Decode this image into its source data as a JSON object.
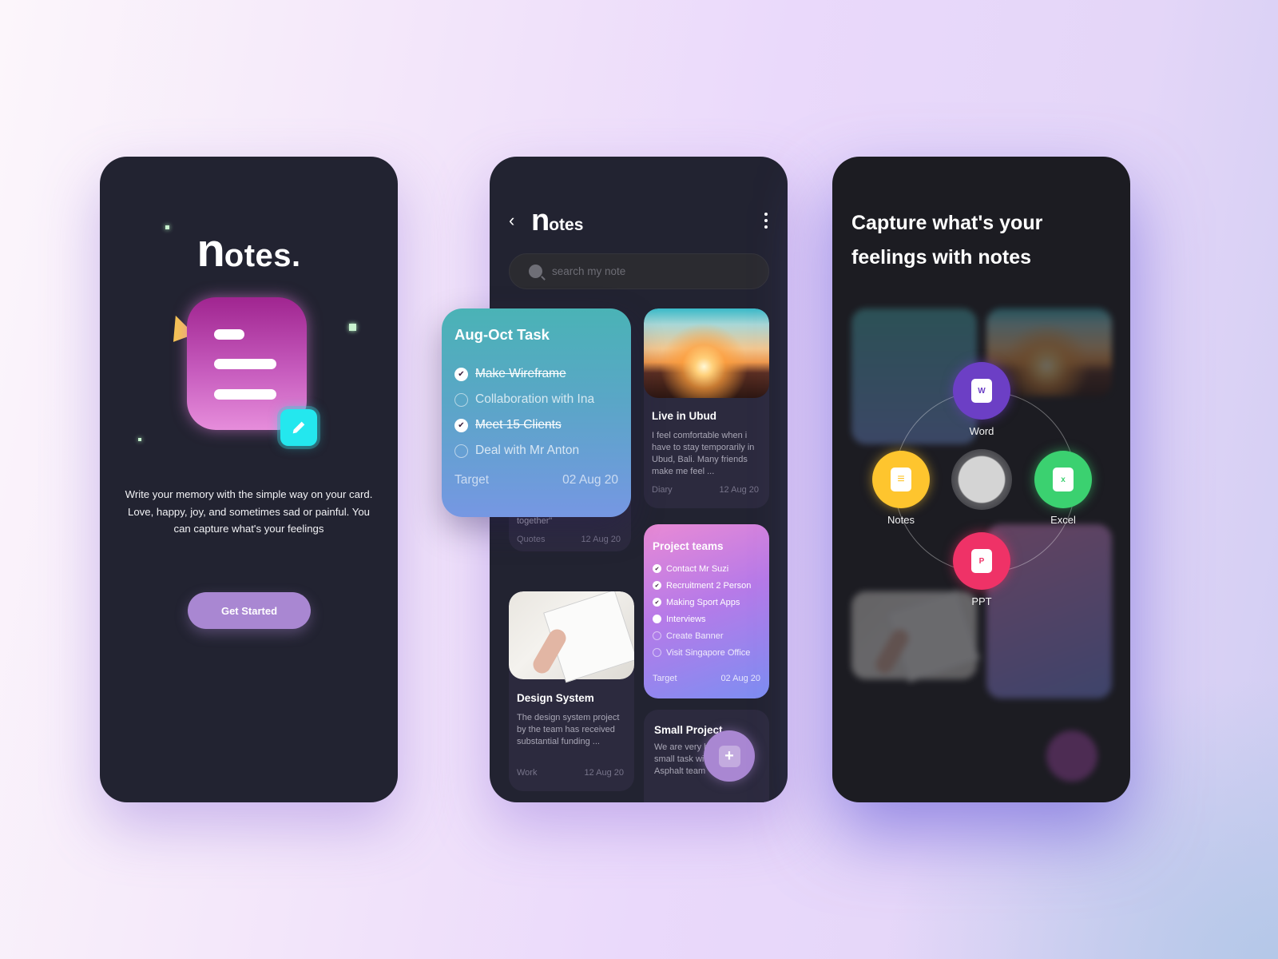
{
  "onboarding": {
    "logo_initial": "n",
    "logo_rest": "otes.",
    "description": "Write your memory with the simple way on your card. Love, happy, joy, and sometimes sad or painful. You can capture what's your feelings",
    "get_started_label": "Get Started"
  },
  "notes_list": {
    "logo_initial": "n",
    "logo_rest": "otes",
    "back_icon": "‹",
    "search_placeholder": "search my note",
    "task_card": {
      "title": "Aug-Oct Task",
      "items": [
        {
          "label": "Make Wireframe",
          "done": true
        },
        {
          "label": "Collaboration with Ina",
          "done": false
        },
        {
          "label": "Meet 15 Clients",
          "done": true
        },
        {
          "label": "Deal with Mr Anton",
          "done": false
        }
      ],
      "footer_label": "Target",
      "footer_date": "02 Aug 20"
    },
    "quotes_card": {
      "body": "so better things can fall together\"",
      "category": "Quotes",
      "date": "12 Aug 20"
    },
    "ubud_card": {
      "title": "Live in Ubud",
      "body": "I feel comfortable when i have to stay temporarily in Ubud, Bali. Many friends make me feel ...",
      "category": "Diary",
      "date": "12 Aug 20"
    },
    "project_card": {
      "title": "Project teams",
      "items": [
        {
          "label": "Contact Mr Suzi",
          "state": "done"
        },
        {
          "label": "Recruitment 2 Person",
          "state": "done"
        },
        {
          "label": "Making Sport Apps",
          "state": "done"
        },
        {
          "label": "Interviews",
          "state": "active"
        },
        {
          "label": "Create Banner",
          "state": "open"
        },
        {
          "label": "Visit Singapore Office",
          "state": "open"
        }
      ],
      "footer_label": "Target",
      "footer_date": "02 Aug 20"
    },
    "design_card": {
      "title": "Design System",
      "body": "The design system project by the team has received substantial funding ...",
      "category": "Work",
      "date": "12 Aug 20"
    },
    "small_card": {
      "title": "Small Project",
      "body": "We are very happy doing small task with by the Asphalt team"
    },
    "fab_label": "+"
  },
  "share_menu": {
    "title": "Capture what's your feelings with notes",
    "options": [
      {
        "label": "Word",
        "glyph": "W",
        "color": "#6c3fc5"
      },
      {
        "label": "Notes",
        "glyph": "≡",
        "color": "#fec52e"
      },
      {
        "label": "Excel",
        "glyph": "x",
        "color": "#3bd170"
      },
      {
        "label": "PPT",
        "glyph": "P",
        "color": "#ef3267"
      }
    ]
  }
}
